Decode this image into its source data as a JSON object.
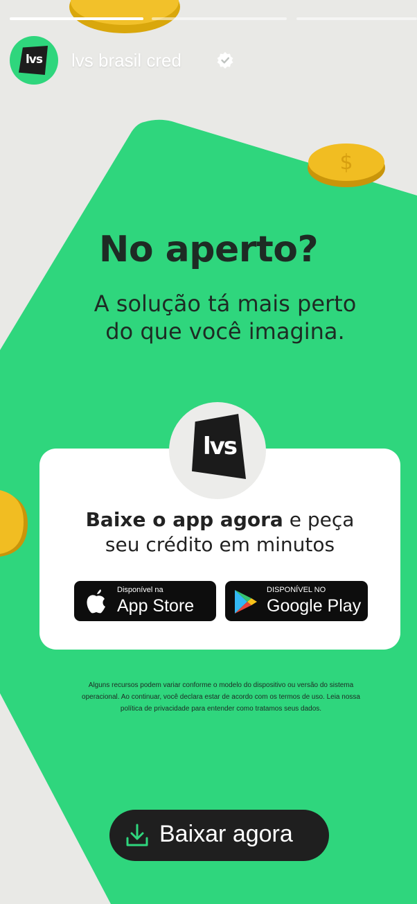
{
  "story": {
    "progress": [
      1,
      0,
      0
    ],
    "account_name": "lvs brasil cred",
    "verified": true,
    "avatar_text": "lvs"
  },
  "ad": {
    "headline": "No aperto?",
    "subheadline_line1": "A solução tá mais perto",
    "subheadline_line2": "do que você imagina.",
    "logo_text": "lvs",
    "cta_bold": "Baixe o app agora",
    "cta_rest_1": " e peça",
    "cta_line2": "seu crédito em minutos",
    "app_store": {
      "small": "Disponível na",
      "big": "App Store"
    },
    "google_play": {
      "small": "DISPONÍVEL NO",
      "big": "Google Play"
    },
    "disclaimer_line1": "Alguns recursos podem variar conforme o modelo do dispositivo ou versão do sistema",
    "disclaimer_line2": "operacional. Ao continuar, você declara estar de acordo com os termos de uso. Leia nossa",
    "disclaimer_line3": "política de privacidade para entender como tratamos seus dados."
  },
  "download_button": {
    "label": "Baixar agora",
    "icon": "download-icon"
  },
  "colors": {
    "brand_green": "#2fd67d",
    "dark": "#1f1f1f",
    "background": "#e9e9e6"
  }
}
